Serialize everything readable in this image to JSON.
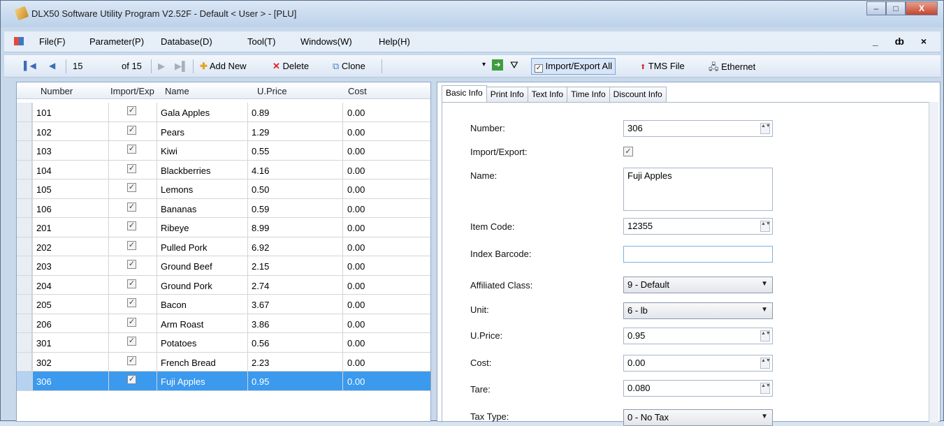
{
  "window": {
    "title": "DLX50 Software Utility Program V2.52F - Default < User > - [PLU]",
    "minimize": "‒",
    "maximize": "□",
    "close": "X"
  },
  "menu": {
    "items": [
      "File(F)",
      "Parameter(P)",
      "Database(D)",
      "Tool(T)",
      "Windows(W)",
      "Help(H)"
    ],
    "mdi_controls": "_ ȸ ×"
  },
  "toolbar": {
    "first": "▌◀",
    "prev": "◀",
    "position": "15",
    "of_total": "of 15",
    "next": "▶",
    "last": "▶▌",
    "add_new": "Add New",
    "delete": "Delete",
    "clone": "Clone",
    "import_export_all": "Import/Export All",
    "tms_file": "TMS File",
    "ethernet": "Ethernet"
  },
  "grid": {
    "columns": [
      "Number",
      "Import/Exp",
      "Name",
      "U.Price",
      "Cost"
    ],
    "rows": [
      {
        "number": "101",
        "name": "Gala Apples",
        "price": "0.89",
        "cost": "0.00"
      },
      {
        "number": "102",
        "name": "Pears",
        "price": "1.29",
        "cost": "0.00"
      },
      {
        "number": "103",
        "name": "Kiwi",
        "price": "0.55",
        "cost": "0.00"
      },
      {
        "number": "104",
        "name": "Blackberries",
        "price": "4.16",
        "cost": "0.00"
      },
      {
        "number": "105",
        "name": "Lemons",
        "price": "0.50",
        "cost": "0.00"
      },
      {
        "number": "106",
        "name": "Bananas",
        "price": "0.59",
        "cost": "0.00"
      },
      {
        "number": "201",
        "name": "Ribeye",
        "price": "8.99",
        "cost": "0.00"
      },
      {
        "number": "202",
        "name": "Pulled Pork",
        "price": "6.92",
        "cost": "0.00"
      },
      {
        "number": "203",
        "name": "Ground Beef",
        "price": "2.15",
        "cost": "0.00"
      },
      {
        "number": "204",
        "name": "Ground Pork",
        "price": "2.74",
        "cost": "0.00"
      },
      {
        "number": "205",
        "name": "Bacon",
        "price": "3.67",
        "cost": "0.00"
      },
      {
        "number": "206",
        "name": "Arm Roast",
        "price": "3.86",
        "cost": "0.00"
      },
      {
        "number": "301",
        "name": "Potatoes",
        "price": "0.56",
        "cost": "0.00"
      },
      {
        "number": "302",
        "name": "French Bread",
        "price": "2.23",
        "cost": "0.00"
      },
      {
        "number": "306",
        "name": "Fuji Apples",
        "price": "0.95",
        "cost": "0.00"
      }
    ],
    "selected_index": 14,
    "check_mark": "✓"
  },
  "tabs": [
    "Basic Info",
    "Print Info",
    "Text Info",
    "Time Info",
    "Discount Info"
  ],
  "form": {
    "number_label": "Number:",
    "number_value": "306",
    "import_export_label": "Import/Export:",
    "name_label": "Name:",
    "name_value": "Fuji Apples",
    "item_code_label": "Item Code:",
    "item_code_value": "12355",
    "index_barcode_label": "Index Barcode:",
    "index_barcode_value": "",
    "affiliated_class_label": "Affiliated Class:",
    "affiliated_class_value": "9 - Default",
    "unit_label": "Unit:",
    "unit_value": "6 - lb",
    "uprice_label": "U.Price:",
    "uprice_value": "0.95",
    "cost_label": "Cost:",
    "cost_value": "0.00",
    "tare_label": "Tare:",
    "tare_value": "0.080",
    "tax_type_label": "Tax Type:",
    "tax_type_value": "0 - No Tax",
    "spin_glyph": "▲▼",
    "dropdown_glyph": "▼"
  },
  "colors": {
    "selection": "#3b99ee",
    "title_gradient_top": "#dbe7f5",
    "accent": "#3d6cb5"
  }
}
